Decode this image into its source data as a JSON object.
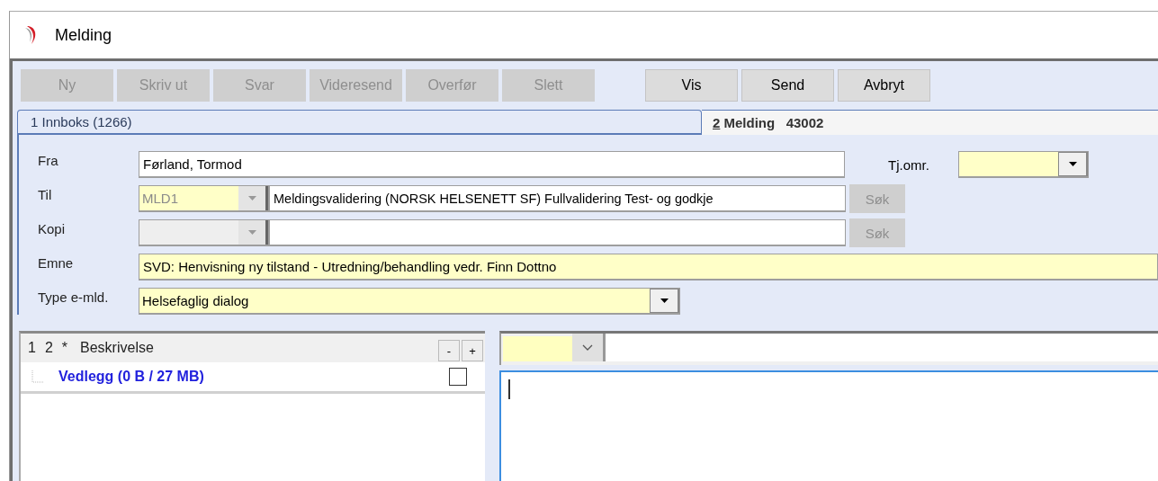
{
  "window": {
    "title": "Melding"
  },
  "toolbar": {
    "buttons": [
      {
        "label": "Ny",
        "disabled": true
      },
      {
        "label": "Skriv ut",
        "disabled": true
      },
      {
        "label": "Svar",
        "disabled": true
      },
      {
        "label": "Videresend",
        "disabled": true
      },
      {
        "label": "Overfør",
        "disabled": true
      },
      {
        "label": "Slett",
        "disabled": true
      },
      {
        "label": "Vis",
        "disabled": false
      },
      {
        "label": "Send",
        "disabled": false
      },
      {
        "label": "Avbryt",
        "disabled": false
      }
    ]
  },
  "tabs": [
    {
      "key": "1",
      "label": "Innboks (1266)",
      "key_underlined": false,
      "selected": false
    },
    {
      "key": "2",
      "label": "Melding",
      "number": "43002",
      "key_underlined": true,
      "selected": true
    }
  ],
  "form": {
    "fra": {
      "label": "Fra",
      "value": "Førland, Tormod"
    },
    "tjomr": {
      "label": "Tj.omr."
    },
    "til": {
      "label": "Til",
      "code": "MLD1",
      "value": "Meldingsvalidering (NORSK HELSENETT SF) Fullvalidering Test- og godkje",
      "button": "Søk",
      "disabled": true
    },
    "kopi": {
      "label": "Kopi",
      "button": "Søk",
      "disabled": true
    },
    "emne": {
      "label": "Emne",
      "value": "SVD: Henvisning ny tilstand - Utredning/behandling vedr. Finn Dottno"
    },
    "type": {
      "label": "Type e-mld.",
      "value": "Helsefaglig dialog"
    }
  },
  "attachments": {
    "header": {
      "col_1": "1",
      "col_2": "2",
      "col_3": "*",
      "title": "Beskrivelse",
      "collapse": "-",
      "expand": "+"
    },
    "items": [
      {
        "label": "Vedlegg (0 B / 27 MB)",
        "checked": false
      }
    ]
  }
}
